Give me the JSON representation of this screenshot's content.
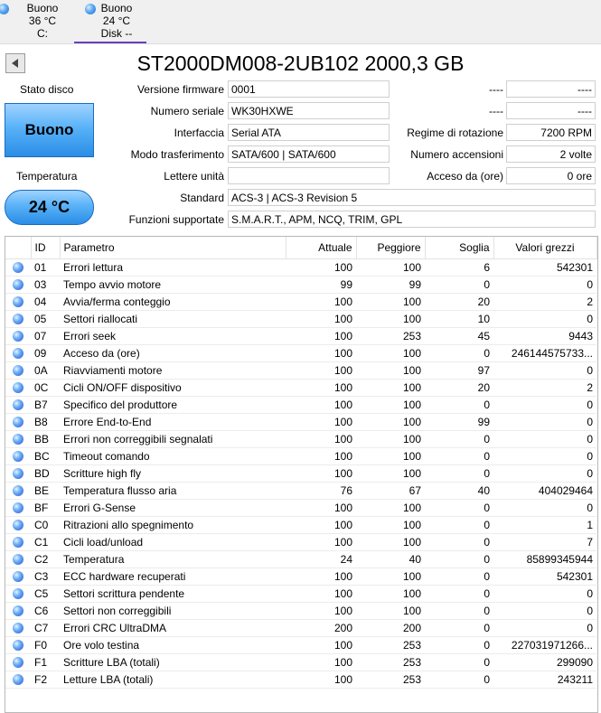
{
  "tabs": [
    {
      "status": "Buono",
      "temp": "36 °C",
      "drive": "C:"
    },
    {
      "status": "Buono",
      "temp": "24 °C",
      "drive": "Disk --"
    }
  ],
  "title": "ST2000DM008-2UB102 2000,3 GB",
  "health": {
    "label": "Stato disco",
    "value": "Buono"
  },
  "temperature": {
    "label": "Temperatura",
    "value": "24 °C"
  },
  "fields": {
    "firmware": {
      "label": "Versione firmware",
      "value": "0001"
    },
    "serial": {
      "label": "Numero seriale",
      "value": "WK30HXWE"
    },
    "interface": {
      "label": "Interfaccia",
      "value": "Serial ATA"
    },
    "transfer": {
      "label": "Modo trasferimento",
      "value": "SATA/600 | SATA/600"
    },
    "letters": {
      "label": "Lettere unità",
      "value": ""
    },
    "standard": {
      "label": "Standard",
      "value": "ACS-3 | ACS-3 Revision 5"
    },
    "features": {
      "label": "Funzioni supportate",
      "value": "S.M.A.R.T., APM, NCQ, TRIM, GPL"
    },
    "right1": {
      "label": "----",
      "value": "----"
    },
    "right2": {
      "label": "----",
      "value": "----"
    },
    "rotation": {
      "label": "Regime di rotazione",
      "value": "7200 RPM"
    },
    "power_count": {
      "label": "Numero accensioni",
      "value": "2 volte"
    },
    "power_hours": {
      "label": "Acceso da (ore)",
      "value": "0 ore"
    }
  },
  "table": {
    "headers": {
      "id": "ID",
      "param": "Parametro",
      "current": "Attuale",
      "worst": "Peggiore",
      "threshold": "Soglia",
      "raw": "Valori grezzi"
    },
    "rows": [
      {
        "id": "01",
        "name": "Errori lettura",
        "cur": "100",
        "worst": "100",
        "thr": "6",
        "raw": "542301"
      },
      {
        "id": "03",
        "name": "Tempo avvio motore",
        "cur": "99",
        "worst": "99",
        "thr": "0",
        "raw": "0"
      },
      {
        "id": "04",
        "name": "Avvia/ferma conteggio",
        "cur": "100",
        "worst": "100",
        "thr": "20",
        "raw": "2"
      },
      {
        "id": "05",
        "name": "Settori riallocati",
        "cur": "100",
        "worst": "100",
        "thr": "10",
        "raw": "0"
      },
      {
        "id": "07",
        "name": "Errori seek",
        "cur": "100",
        "worst": "253",
        "thr": "45",
        "raw": "9443"
      },
      {
        "id": "09",
        "name": "Acceso da (ore)",
        "cur": "100",
        "worst": "100",
        "thr": "0",
        "raw": "246144575733..."
      },
      {
        "id": "0A",
        "name": "Riavviamenti motore",
        "cur": "100",
        "worst": "100",
        "thr": "97",
        "raw": "0"
      },
      {
        "id": "0C",
        "name": "Cicli ON/OFF dispositivo",
        "cur": "100",
        "worst": "100",
        "thr": "20",
        "raw": "2"
      },
      {
        "id": "B7",
        "name": "Specifico del produttore",
        "cur": "100",
        "worst": "100",
        "thr": "0",
        "raw": "0"
      },
      {
        "id": "B8",
        "name": "Errore End-to-End",
        "cur": "100",
        "worst": "100",
        "thr": "99",
        "raw": "0"
      },
      {
        "id": "BB",
        "name": "Errori non correggibili segnalati",
        "cur": "100",
        "worst": "100",
        "thr": "0",
        "raw": "0"
      },
      {
        "id": "BC",
        "name": "Timeout comando",
        "cur": "100",
        "worst": "100",
        "thr": "0",
        "raw": "0"
      },
      {
        "id": "BD",
        "name": "Scritture high fly",
        "cur": "100",
        "worst": "100",
        "thr": "0",
        "raw": "0"
      },
      {
        "id": "BE",
        "name": "Temperatura flusso aria",
        "cur": "76",
        "worst": "67",
        "thr": "40",
        "raw": "404029464"
      },
      {
        "id": "BF",
        "name": "Errori G-Sense",
        "cur": "100",
        "worst": "100",
        "thr": "0",
        "raw": "0"
      },
      {
        "id": "C0",
        "name": "Ritrazioni allo spegnimento",
        "cur": "100",
        "worst": "100",
        "thr": "0",
        "raw": "1"
      },
      {
        "id": "C1",
        "name": "Cicli load/unload",
        "cur": "100",
        "worst": "100",
        "thr": "0",
        "raw": "7"
      },
      {
        "id": "C2",
        "name": "Temperatura",
        "cur": "24",
        "worst": "40",
        "thr": "0",
        "raw": "85899345944"
      },
      {
        "id": "C3",
        "name": "ECC hardware recuperati",
        "cur": "100",
        "worst": "100",
        "thr": "0",
        "raw": "542301"
      },
      {
        "id": "C5",
        "name": "Settori scrittura pendente",
        "cur": "100",
        "worst": "100",
        "thr": "0",
        "raw": "0"
      },
      {
        "id": "C6",
        "name": "Settori non correggibili",
        "cur": "100",
        "worst": "100",
        "thr": "0",
        "raw": "0"
      },
      {
        "id": "C7",
        "name": "Errori CRC UltraDMA",
        "cur": "200",
        "worst": "200",
        "thr": "0",
        "raw": "0"
      },
      {
        "id": "F0",
        "name": "Ore volo testina",
        "cur": "100",
        "worst": "253",
        "thr": "0",
        "raw": "227031971266..."
      },
      {
        "id": "F1",
        "name": "Scritture LBA (totali)",
        "cur": "100",
        "worst": "253",
        "thr": "0",
        "raw": "299090"
      },
      {
        "id": "F2",
        "name": "Letture LBA (totali)",
        "cur": "100",
        "worst": "253",
        "thr": "0",
        "raw": "243211"
      }
    ]
  }
}
